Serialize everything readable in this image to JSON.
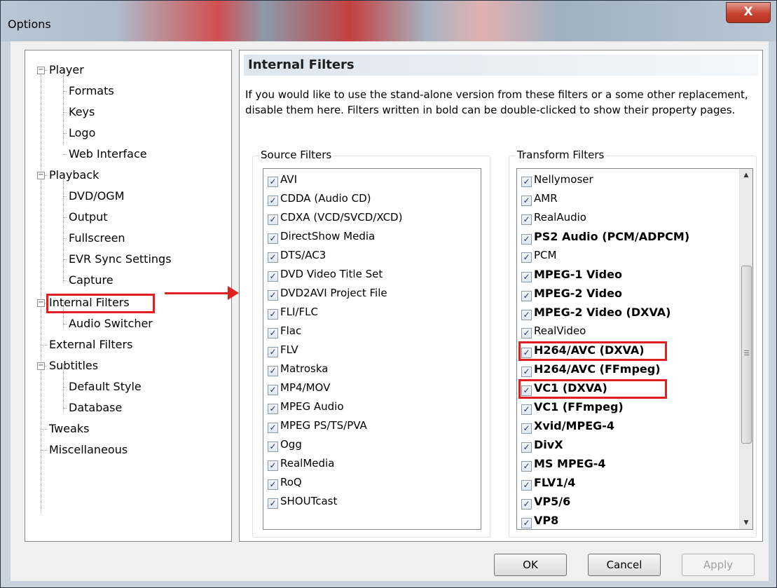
{
  "window": {
    "title": "Options",
    "close_glyph": "X"
  },
  "tree": {
    "items": [
      {
        "label": "Player"
      },
      {
        "label": "Formats"
      },
      {
        "label": "Keys"
      },
      {
        "label": "Logo"
      },
      {
        "label": "Web Interface"
      },
      {
        "label": "Playback"
      },
      {
        "label": "DVD/OGM"
      },
      {
        "label": "Output"
      },
      {
        "label": "Fullscreen"
      },
      {
        "label": "EVR Sync Settings"
      },
      {
        "label": "Capture"
      },
      {
        "label": "Internal Filters"
      },
      {
        "label": "Audio Switcher"
      },
      {
        "label": "External Filters"
      },
      {
        "label": "Subtitles"
      },
      {
        "label": "Default Style"
      },
      {
        "label": "Database"
      },
      {
        "label": "Tweaks"
      },
      {
        "label": "Miscellaneous"
      }
    ],
    "selected": "Internal Filters"
  },
  "panel": {
    "title": "Internal Filters",
    "description": "If you would like to use the stand-alone version from these filters or a some other replacement, disable them here. Filters written in bold can be double-clicked to show their property pages."
  },
  "source_filters": {
    "label": "Source Filters",
    "items": [
      {
        "label": "AVI",
        "checked": true
      },
      {
        "label": "CDDA (Audio CD)",
        "checked": true
      },
      {
        "label": "CDXA (VCD/SVCD/XCD)",
        "checked": true
      },
      {
        "label": "DirectShow Media",
        "checked": true
      },
      {
        "label": "DTS/AC3",
        "checked": true
      },
      {
        "label": "DVD Video Title Set",
        "checked": true
      },
      {
        "label": "DVD2AVI Project File",
        "checked": true
      },
      {
        "label": "FLI/FLC",
        "checked": true
      },
      {
        "label": "Flac",
        "checked": true
      },
      {
        "label": "FLV",
        "checked": true
      },
      {
        "label": "Matroska",
        "checked": true
      },
      {
        "label": "MP4/MOV",
        "checked": true
      },
      {
        "label": "MPEG Audio",
        "checked": true
      },
      {
        "label": "MPEG PS/TS/PVA",
        "checked": true
      },
      {
        "label": "Ogg",
        "checked": true
      },
      {
        "label": "RealMedia",
        "checked": true
      },
      {
        "label": "RoQ",
        "checked": true
      },
      {
        "label": "SHOUTcast",
        "checked": true
      }
    ]
  },
  "transform_filters": {
    "label": "Transform Filters",
    "items": [
      {
        "label": "Nellymoser",
        "checked": true,
        "bold": false
      },
      {
        "label": "AMR",
        "checked": true,
        "bold": false
      },
      {
        "label": "RealAudio",
        "checked": true,
        "bold": false
      },
      {
        "label": "PS2 Audio (PCM/ADPCM)",
        "checked": true,
        "bold": true
      },
      {
        "label": "PCM",
        "checked": true,
        "bold": false
      },
      {
        "label": "MPEG-1 Video",
        "checked": true,
        "bold": true
      },
      {
        "label": "MPEG-2 Video",
        "checked": true,
        "bold": true
      },
      {
        "label": "MPEG-2 Video (DXVA)",
        "checked": true,
        "bold": true
      },
      {
        "label": "RealVideo",
        "checked": true,
        "bold": false
      },
      {
        "label": "H264/AVC (DXVA)",
        "checked": true,
        "bold": true,
        "highlighted": true
      },
      {
        "label": "H264/AVC (FFmpeg)",
        "checked": true,
        "bold": true
      },
      {
        "label": "VC1 (DXVA)",
        "checked": true,
        "bold": true,
        "highlighted": true
      },
      {
        "label": "VC1 (FFmpeg)",
        "checked": true,
        "bold": true
      },
      {
        "label": "Xvid/MPEG-4",
        "checked": true,
        "bold": true
      },
      {
        "label": "DivX",
        "checked": true,
        "bold": true
      },
      {
        "label": "MS MPEG-4",
        "checked": true,
        "bold": true
      },
      {
        "label": "FLV1/4",
        "checked": true,
        "bold": true
      },
      {
        "label": "VP5/6",
        "checked": true,
        "bold": true
      },
      {
        "label": "VP8",
        "checked": true,
        "bold": true
      }
    ]
  },
  "buttons": {
    "ok": "OK",
    "cancel": "Cancel",
    "apply": "Apply",
    "apply_enabled": false
  },
  "colors": {
    "highlight": "#e02020"
  }
}
